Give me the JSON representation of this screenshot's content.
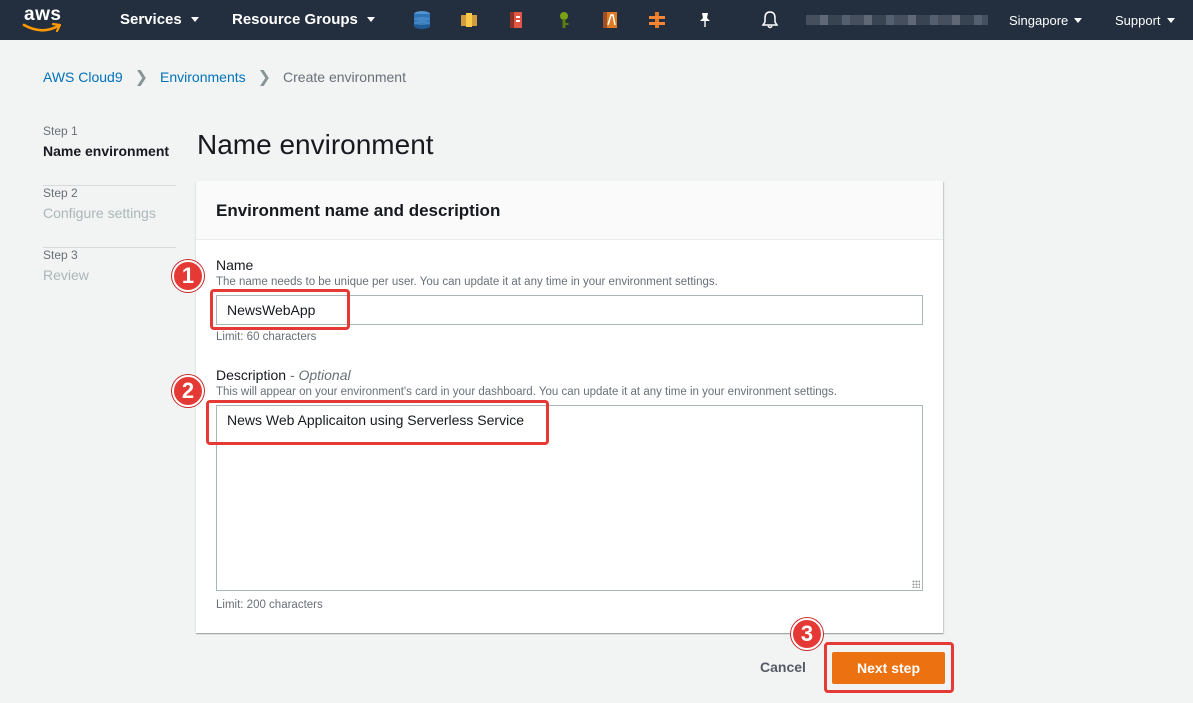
{
  "nav": {
    "logo_text": "aws",
    "services_label": "Services",
    "resource_groups_label": "Resource Groups",
    "region_label": "Singapore",
    "support_label": "Support",
    "service_icons": [
      "dynamodb-icon",
      "s3-icon",
      "cloudformation-icon",
      "iam-icon",
      "lambda-icon",
      "api-gateway-icon",
      "pin-icon"
    ],
    "bg_color": "#232f3e"
  },
  "breadcrumb": {
    "items": [
      "AWS Cloud9",
      "Environments",
      "Create environment"
    ]
  },
  "steps": [
    {
      "num": "Step 1",
      "title": "Name environment",
      "state": "active"
    },
    {
      "num": "Step 2",
      "title": "Configure settings",
      "state": "inactive"
    },
    {
      "num": "Step 3",
      "title": "Review",
      "state": "inactive"
    }
  ],
  "page_title": "Name environment",
  "panel": {
    "title": "Environment name and description",
    "name": {
      "label": "Name",
      "hint": "The name needs to be unique per user. You can update it at any time in your environment settings.",
      "value": "NewsWebApp",
      "limit": "Limit: 60 characters"
    },
    "description": {
      "label": "Description",
      "optional": "- Optional",
      "hint": "This will appear on your environment's card in your dashboard. You can update it at any time in your environment settings.",
      "value": "News Web Applicaiton using Serverless Service",
      "limit": "Limit: 200 characters"
    }
  },
  "actions": {
    "cancel_label": "Cancel",
    "next_label": "Next step",
    "primary_color": "#ec7211"
  },
  "annotations": {
    "badges": [
      "1",
      "2",
      "3"
    ],
    "color": "#e53935"
  }
}
